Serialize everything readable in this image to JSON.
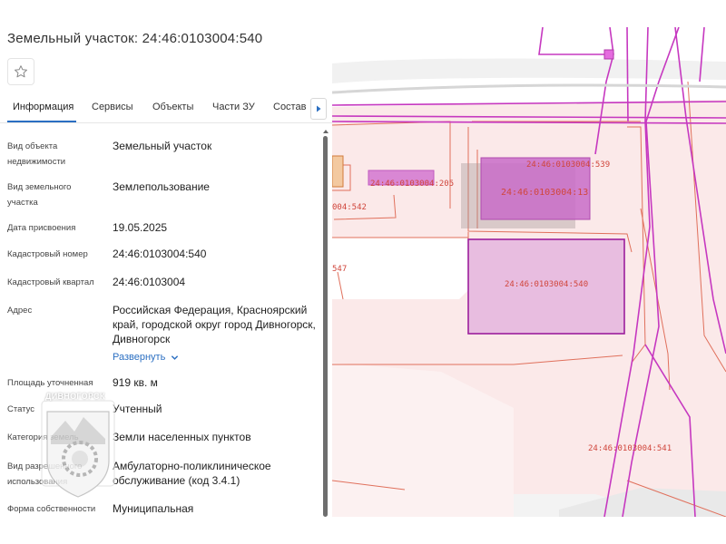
{
  "panel": {
    "title": "Земельный участок: 24:46:0103004:540",
    "tabs": [
      {
        "label": "Информация"
      },
      {
        "label": "Сервисы"
      },
      {
        "label": "Объекты"
      },
      {
        "label": "Части ЗУ"
      },
      {
        "label": "Состав"
      }
    ],
    "rows": [
      {
        "label": "Вид объекта недвижимости",
        "value": "Земельный участок"
      },
      {
        "label": "Вид земельного участка",
        "value": "Землепользование"
      },
      {
        "label": "Дата присвоения",
        "value": "19.05.2025"
      },
      {
        "label": "Кадастровый номер",
        "value": "24:46:0103004:540"
      },
      {
        "label": "Кадастровый квартал",
        "value": "24:46:0103004"
      },
      {
        "label": "Адрес",
        "value": "Российская Федерация, Красноярский край, городской округ город Дивногорск, Дивногорск"
      },
      {
        "label": "Площадь уточненная",
        "value": "919 кв. м"
      },
      {
        "label": "Статус",
        "value": "Учтенный"
      },
      {
        "label": "Категория земель",
        "value": "Земли населенных пунктов"
      },
      {
        "label": "Вид разрешенного использования",
        "value": "Амбулаторно-поликлиническое обслуживание (код 3.4.1)"
      },
      {
        "label": "Форма собственности",
        "value": "Муниципальная"
      }
    ],
    "expand_label": "Развернуть",
    "emblem_text": "ДИВНОГОРСК"
  },
  "map": {
    "parcel_labels": [
      {
        "text": "24:46:0103004:539"
      },
      {
        "text": "24:46:0103004:205"
      },
      {
        "text": "24:46:0103004:13"
      },
      {
        "text": "24:46:0103004:540"
      },
      {
        "text": "24:46:0103004:541"
      },
      {
        "text": "004:542"
      },
      {
        "text": "547"
      }
    ],
    "colors": {
      "background": "#fbe9e9",
      "parcel_border": "#e0705c",
      "road": "#c638c0",
      "selected_fill": "#e8bde0",
      "selected_border": "#9c1f9c",
      "label": "#d0463c"
    }
  }
}
